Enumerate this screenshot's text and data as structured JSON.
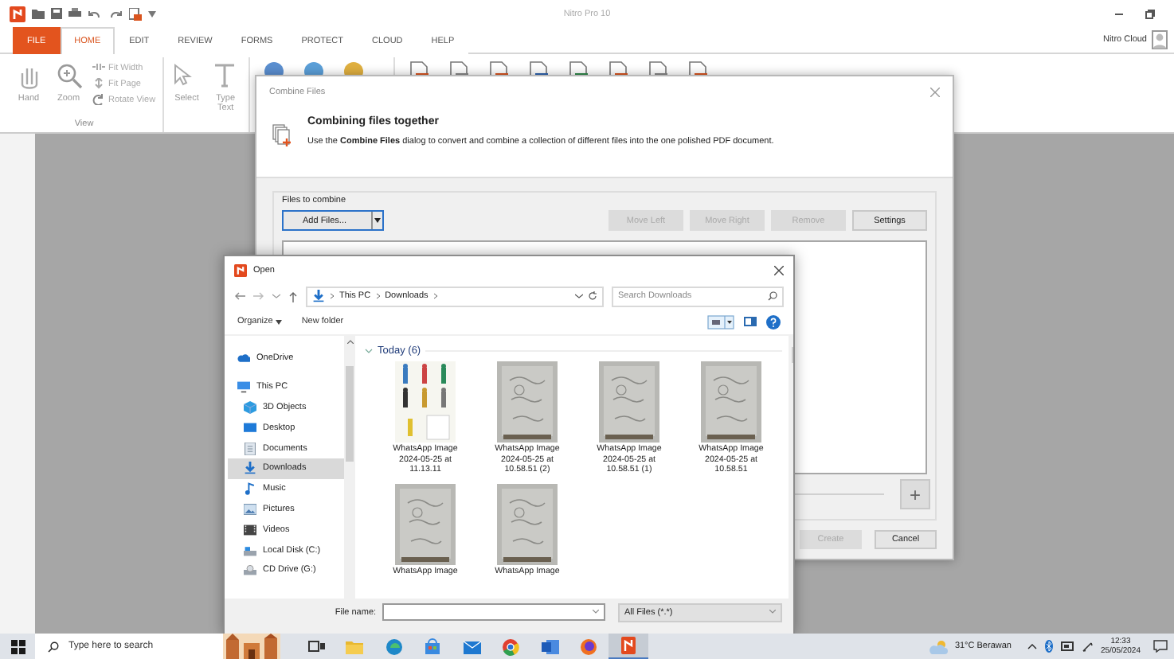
{
  "app": {
    "title": "Nitro Pro 10",
    "tabs": [
      {
        "label": "FILE",
        "selected": false,
        "kind": "file"
      },
      {
        "label": "HOME",
        "selected": true,
        "kind": "tab"
      },
      {
        "label": "EDIT",
        "selected": false,
        "kind": "tab"
      },
      {
        "label": "REVIEW",
        "selected": false,
        "kind": "tab"
      },
      {
        "label": "FORMS",
        "selected": false,
        "kind": "tab"
      },
      {
        "label": "PROTECT",
        "selected": false,
        "kind": "tab"
      },
      {
        "label": "CLOUD",
        "selected": false,
        "kind": "tab"
      },
      {
        "label": "HELP",
        "selected": false,
        "kind": "tab"
      }
    ],
    "account": "Nitro Cloud",
    "ribbon": {
      "large_buttons": [
        "Hand",
        "Zoom"
      ],
      "small_buttons": [
        "Fit Width",
        "Fit Page",
        "Rotate View"
      ],
      "group_label": "View",
      "edit_buttons": [
        "Select",
        "Type Text"
      ]
    }
  },
  "combine_dialog": {
    "title": "Combine Files",
    "heading": "Combining files together",
    "description": "Use the **Combine Files** dialog to convert and combine a collection of different files into the one polished PDF document.",
    "group_label": "Files to combine",
    "buttons": [
      {
        "label": "Add Files...",
        "kind": "split",
        "disabled": false
      },
      {
        "label": "Move Left",
        "kind": "plain",
        "disabled": true
      },
      {
        "label": "Move Right",
        "kind": "plain",
        "disabled": true
      },
      {
        "label": "Remove",
        "kind": "plain",
        "disabled": true
      },
      {
        "label": "Settings",
        "kind": "plain",
        "disabled": false
      }
    ],
    "add_button": "+",
    "footer_buttons": [
      {
        "label": "Create",
        "disabled": true
      },
      {
        "label": "Cancel",
        "disabled": false
      }
    ]
  },
  "open_dialog": {
    "title": "Open",
    "breadcrumb": [
      "This PC",
      "Downloads"
    ],
    "search": {
      "placeholder": "Search Downloads"
    },
    "organize": "Organize",
    "new_folder": "New folder",
    "nav_items": [
      {
        "label": "OneDrive",
        "kind": "cloud",
        "selected": false
      },
      {
        "label": "This PC",
        "kind": "pc",
        "selected": false,
        "children": [
          {
            "label": "3D Objects",
            "kind": "cube",
            "selected": false
          },
          {
            "label": "Desktop",
            "kind": "desktop",
            "selected": false
          },
          {
            "label": "Documents",
            "kind": "document",
            "selected": false
          },
          {
            "label": "Downloads",
            "kind": "download",
            "selected": true
          },
          {
            "label": "Music",
            "kind": "music",
            "selected": false
          },
          {
            "label": "Pictures",
            "kind": "pictures",
            "selected": false
          },
          {
            "label": "Videos",
            "kind": "videos",
            "selected": false
          },
          {
            "label": "Local Disk (C:)",
            "kind": "disk",
            "selected": false
          },
          {
            "label": "CD Drive (G:)",
            "kind": "cd",
            "selected": false
          }
        ]
      }
    ],
    "group": {
      "label": "Today (6)",
      "expanded": true
    },
    "files": [
      {
        "lines": [
          "WhatsApp Image",
          "2024-05-25 at",
          "11.13.11"
        ]
      },
      {
        "lines": [
          "WhatsApp Image",
          "2024-05-25 at",
          "10.58.51 (2)"
        ]
      },
      {
        "lines": [
          "WhatsApp Image",
          "2024-05-25 at",
          "10.58.51 (1)"
        ]
      },
      {
        "lines": [
          "WhatsApp Image",
          "2024-05-25 at",
          "10.58.51"
        ]
      },
      {
        "lines": [
          "WhatsApp Image"
        ]
      },
      {
        "lines": [
          "WhatsApp Image"
        ]
      }
    ],
    "file_name_label": "File name:",
    "filter": "All Files (*.*)"
  },
  "taskbar": {
    "search": {
      "placeholder": "Type here to search"
    },
    "apps": [
      {
        "kind": "task-view",
        "selected": false
      },
      {
        "kind": "folder",
        "selected": false
      },
      {
        "kind": "edge",
        "selected": false
      },
      {
        "kind": "store",
        "selected": false
      },
      {
        "kind": "mail",
        "selected": false
      },
      {
        "kind": "chrome",
        "selected": false
      },
      {
        "kind": "word",
        "selected": false
      },
      {
        "kind": "firefox",
        "selected": false
      },
      {
        "kind": "nitro",
        "selected": true
      }
    ],
    "weather": "31°C Berawan",
    "time": "12:33",
    "date": "25/05/2024"
  }
}
